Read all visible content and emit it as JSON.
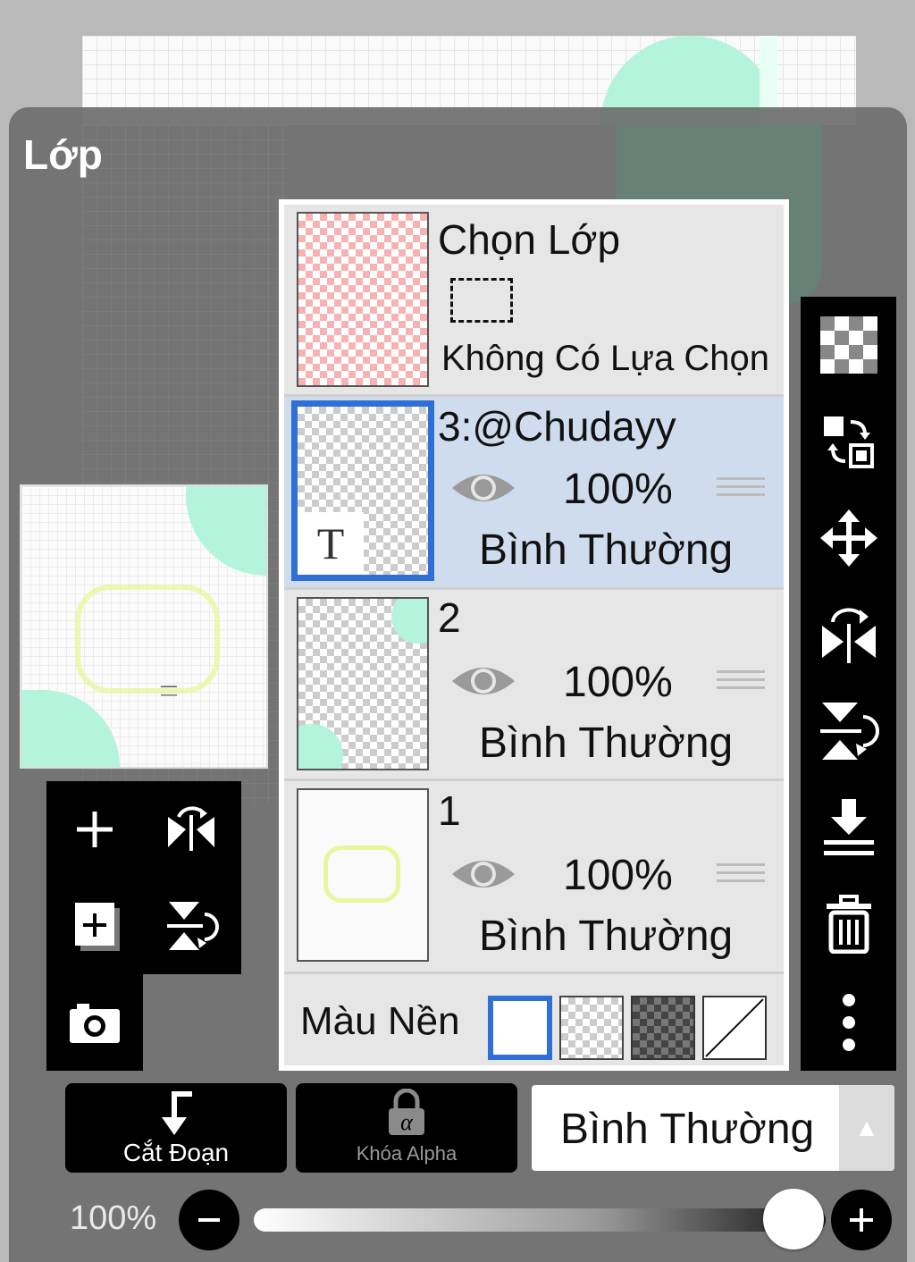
{
  "panel": {
    "title": "Lớp"
  },
  "selection": {
    "title": "Chọn Lớp",
    "status": "Không Có Lựa Chọn"
  },
  "layers": [
    {
      "name": "3:@Chudayy",
      "opacity": "100%",
      "blend": "Bình Thường",
      "thumb_badge": "T",
      "active": true,
      "visible": true
    },
    {
      "name": "2",
      "opacity": "100%",
      "blend": "Bình Thường",
      "active": false,
      "visible": true
    },
    {
      "name": "1",
      "opacity": "100%",
      "blend": "Bình Thường",
      "active": false,
      "visible": true
    }
  ],
  "background": {
    "label": "Màu Nền",
    "options": [
      "white",
      "checker-light",
      "checker-dark",
      "none"
    ],
    "selected": "white"
  },
  "bottom": {
    "clip_label": "Cắt Đoạn",
    "alpha_lock_label": "Khóa Alpha",
    "blend_mode": "Bình Thường"
  },
  "opacity": {
    "label": "100%",
    "value": 1.0
  },
  "colors": {
    "accent": "#2f6fd6",
    "active_row": "#cfdcee",
    "panel": "#6e6e6e"
  },
  "icons": {
    "left_tools": [
      "add-layer-icon",
      "flip-horizontal-icon",
      "duplicate-layer-icon",
      "flip-vertical-icon",
      "camera-icon"
    ],
    "right_tools": [
      "transparency-icon",
      "swap-layers-icon",
      "move-icon",
      "flip-horizontal-icon",
      "flip-vertical-icon",
      "merge-down-icon",
      "delete-icon",
      "more-icon"
    ]
  }
}
